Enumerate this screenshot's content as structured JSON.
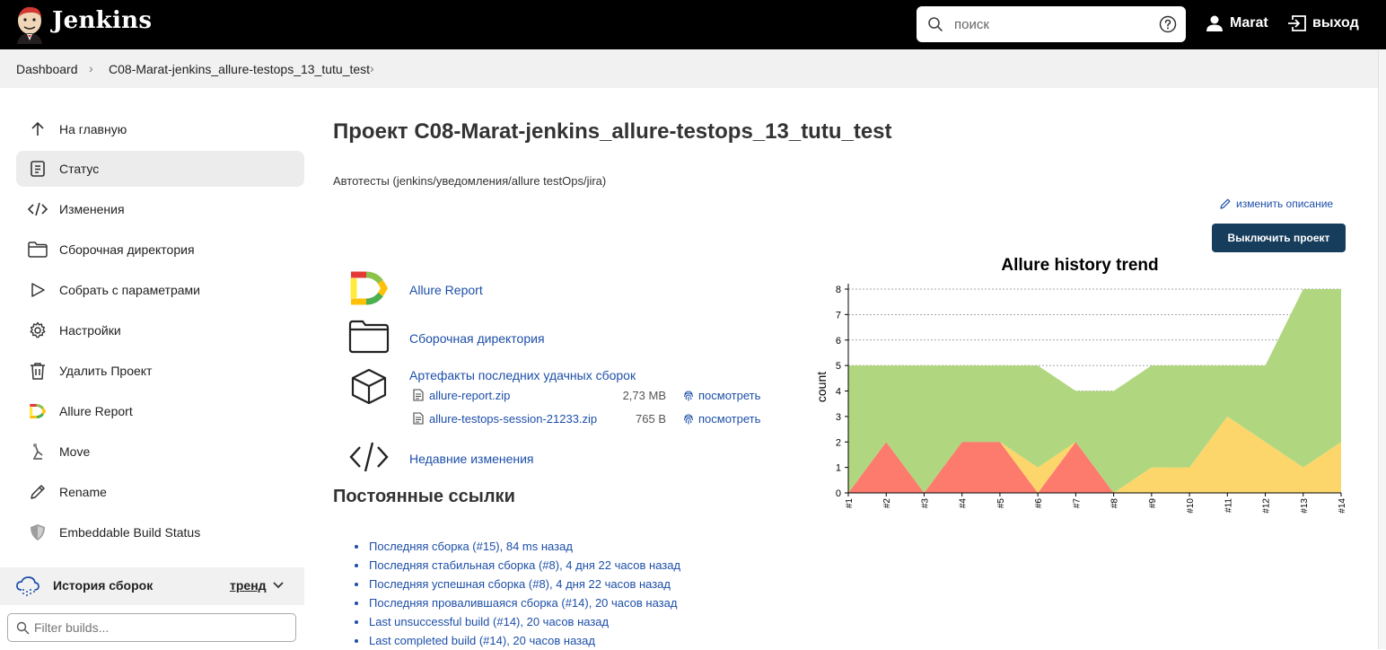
{
  "header": {
    "brand": "Jenkins",
    "search_placeholder": "поиск",
    "user": "Marat",
    "logout": "выход"
  },
  "breadcrumb": [
    "Dashboard",
    "C08-Marat-jenkins_allure-testops_13_tutu_test"
  ],
  "sidebar": {
    "items": [
      {
        "label": "На главную",
        "icon": "arrow-up-icon"
      },
      {
        "label": "Статус",
        "icon": "clipboard-icon",
        "active": true
      },
      {
        "label": "Изменения",
        "icon": "code-icon"
      },
      {
        "label": "Сборочная директория",
        "icon": "folder-icon"
      },
      {
        "label": "Собрать с параметрами",
        "icon": "play-icon"
      },
      {
        "label": "Настройки",
        "icon": "gear-icon"
      },
      {
        "label": "Удалить Проект",
        "icon": "trash-icon"
      },
      {
        "label": "Allure Report",
        "icon": "allure-icon"
      },
      {
        "label": "Move",
        "icon": "move-icon"
      },
      {
        "label": "Rename",
        "icon": "pencil-icon"
      },
      {
        "label": "Embeddable Build Status",
        "icon": "shield-icon"
      }
    ],
    "history_title": "История сборок",
    "history_trend": "тренд",
    "filter_placeholder": "Filter builds..."
  },
  "main": {
    "title": "Проект C08-Marat-jenkins_allure-testops_13_tutu_test",
    "description": "Автотесты (jenkins/уведомления/allure testOps/jira)",
    "edit_description": "изменить описание",
    "disable_button": "Выключить проект",
    "tasks": {
      "allure": "Allure Report",
      "workspace": "Сборочная директория",
      "artifacts": "Артефакты последних удачных сборок",
      "changes": "Недавние изменения"
    },
    "artifacts": [
      {
        "name": "allure-report.zip",
        "size": "2,73 MB",
        "view": "посмотреть"
      },
      {
        "name": "allure-testops-session-21233.zip",
        "size": "765 B",
        "view": "посмотреть"
      }
    ],
    "permalinks_title": "Постоянные ссылки",
    "permalinks": [
      "Последняя сборка (#15), 84 ms назад",
      "Последняя стабильная сборка (#8), 4 дня 22 часов назад",
      "Последняя успешная сборка (#8), 4 дня 22 часов назад",
      "Последняя провалившаяся сборка (#14), 20 часов назад",
      "Last unsuccessful build (#14), 20 часов назад",
      "Last completed build (#14), 20 часов назад"
    ]
  },
  "chart_data": {
    "type": "area",
    "title": "Allure history trend",
    "xlabel": "",
    "ylabel": "count",
    "categories": [
      "#1",
      "#2",
      "#3",
      "#4",
      "#5",
      "#6",
      "#7",
      "#8",
      "#9",
      "#10",
      "#11",
      "#12",
      "#13",
      "#14"
    ],
    "ylim": [
      0,
      8
    ],
    "yticks": [
      0,
      1,
      2,
      3,
      4,
      5,
      6,
      7,
      8
    ],
    "grid": true,
    "stacked": true,
    "series": [
      {
        "values": [
          0,
          2,
          0,
          2,
          2,
          0,
          2,
          0,
          0,
          0,
          0,
          0,
          0,
          0
        ],
        "color": "#fd7b6d"
      },
      {
        "values": [
          0,
          0,
          0,
          0,
          0,
          1,
          0,
          0,
          1,
          1,
          3,
          2,
          1,
          2
        ],
        "color": "#fdd66b"
      },
      {
        "values": [
          5,
          3,
          5,
          3,
          3,
          4,
          2,
          4,
          4,
          4,
          2,
          3,
          7,
          6
        ],
        "color": "#b0d77f"
      }
    ]
  },
  "colors": {
    "header_bg": "#000000",
    "link": "#1d4fa8",
    "button_bg": "#173d5d",
    "sidebar_active": "#ececec"
  }
}
